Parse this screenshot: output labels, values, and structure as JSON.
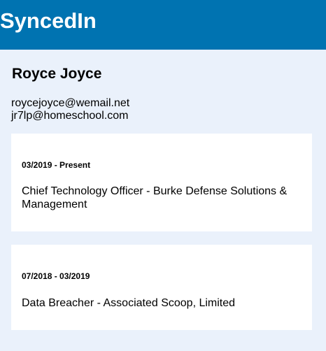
{
  "header": {
    "brand": "SyncedIn"
  },
  "profile": {
    "name": "Royce Joyce",
    "emails": [
      "roycejoyce@wemail.net",
      "jr7lp@homeschool.com"
    ]
  },
  "experience": [
    {
      "dates": "03/2019 - Present",
      "role": "Chief Technology Officer - Burke Defense Solutions & Management"
    },
    {
      "dates": "07/2018 - 03/2019",
      "role": "Data Breacher - Associated Scoop, Limited"
    }
  ],
  "colors": {
    "header_bg": "#0073b1",
    "page_bg": "#eaf1fb",
    "card_bg": "#ffffff"
  }
}
